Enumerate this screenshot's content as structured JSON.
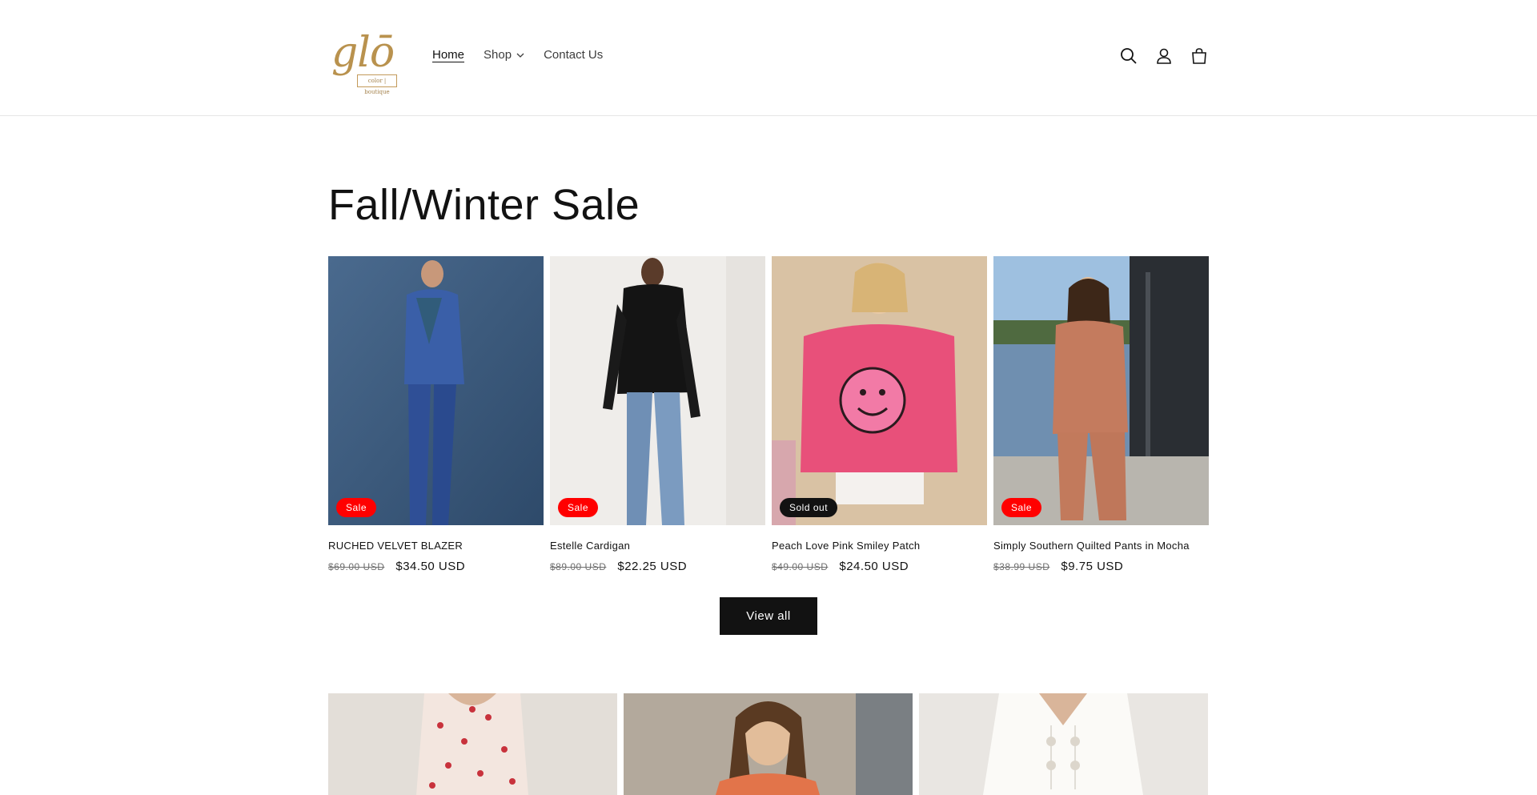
{
  "header": {
    "logo_text": "glō",
    "logo_tagline": "color | boutique",
    "nav": [
      {
        "label": "Home"
      },
      {
        "label": "Shop"
      },
      {
        "label": "Contact Us"
      }
    ],
    "icons": [
      "search-icon",
      "account-icon",
      "cart-icon"
    ]
  },
  "section": {
    "title": "Fall/Winter Sale",
    "view_all_label": "View all"
  },
  "products": [
    {
      "name": "RUCHED VELVET BLAZER",
      "old_price": "$69.00 USD",
      "price": "$34.50 USD",
      "badge": "Sale"
    },
    {
      "name": "Estelle Cardigan",
      "old_price": "$89.00 USD",
      "price": "$22.25 USD",
      "badge": "Sale"
    },
    {
      "name": "Peach Love Pink Smiley Patch",
      "old_price": "$49.00 USD",
      "price": "$24.50 USD",
      "badge": "Sold out"
    },
    {
      "name": "Simply Southern Quilted Pants in Mocha",
      "old_price": "$38.99 USD",
      "price": "$9.75 USD",
      "badge": "Sale"
    }
  ],
  "colors": {
    "sale_badge": "#ff0000",
    "sold_badge": "#121212",
    "button": "#121212",
    "logo_gold": "#b9924e"
  }
}
